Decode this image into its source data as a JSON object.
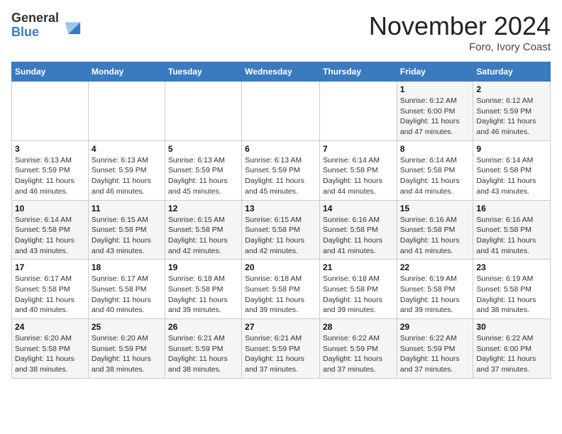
{
  "header": {
    "logo_general": "General",
    "logo_blue": "Blue",
    "month_title": "November 2024",
    "location": "Foro, Ivory Coast"
  },
  "weekdays": [
    "Sunday",
    "Monday",
    "Tuesday",
    "Wednesday",
    "Thursday",
    "Friday",
    "Saturday"
  ],
  "weeks": [
    [
      {
        "day": "",
        "info": ""
      },
      {
        "day": "",
        "info": ""
      },
      {
        "day": "",
        "info": ""
      },
      {
        "day": "",
        "info": ""
      },
      {
        "day": "",
        "info": ""
      },
      {
        "day": "1",
        "info": "Sunrise: 6:12 AM\nSunset: 6:00 PM\nDaylight: 11 hours and 47 minutes."
      },
      {
        "day": "2",
        "info": "Sunrise: 6:12 AM\nSunset: 5:59 PM\nDaylight: 11 hours and 46 minutes."
      }
    ],
    [
      {
        "day": "3",
        "info": "Sunrise: 6:13 AM\nSunset: 5:59 PM\nDaylight: 11 hours and 46 minutes."
      },
      {
        "day": "4",
        "info": "Sunrise: 6:13 AM\nSunset: 5:59 PM\nDaylight: 11 hours and 46 minutes."
      },
      {
        "day": "5",
        "info": "Sunrise: 6:13 AM\nSunset: 5:59 PM\nDaylight: 11 hours and 45 minutes."
      },
      {
        "day": "6",
        "info": "Sunrise: 6:13 AM\nSunset: 5:59 PM\nDaylight: 11 hours and 45 minutes."
      },
      {
        "day": "7",
        "info": "Sunrise: 6:14 AM\nSunset: 5:58 PM\nDaylight: 11 hours and 44 minutes."
      },
      {
        "day": "8",
        "info": "Sunrise: 6:14 AM\nSunset: 5:58 PM\nDaylight: 11 hours and 44 minutes."
      },
      {
        "day": "9",
        "info": "Sunrise: 6:14 AM\nSunset: 5:58 PM\nDaylight: 11 hours and 43 minutes."
      }
    ],
    [
      {
        "day": "10",
        "info": "Sunrise: 6:14 AM\nSunset: 5:58 PM\nDaylight: 11 hours and 43 minutes."
      },
      {
        "day": "11",
        "info": "Sunrise: 6:15 AM\nSunset: 5:58 PM\nDaylight: 11 hours and 43 minutes."
      },
      {
        "day": "12",
        "info": "Sunrise: 6:15 AM\nSunset: 5:58 PM\nDaylight: 11 hours and 42 minutes."
      },
      {
        "day": "13",
        "info": "Sunrise: 6:15 AM\nSunset: 5:58 PM\nDaylight: 11 hours and 42 minutes."
      },
      {
        "day": "14",
        "info": "Sunrise: 6:16 AM\nSunset: 5:58 PM\nDaylight: 11 hours and 41 minutes."
      },
      {
        "day": "15",
        "info": "Sunrise: 6:16 AM\nSunset: 5:58 PM\nDaylight: 11 hours and 41 minutes."
      },
      {
        "day": "16",
        "info": "Sunrise: 6:16 AM\nSunset: 5:58 PM\nDaylight: 11 hours and 41 minutes."
      }
    ],
    [
      {
        "day": "17",
        "info": "Sunrise: 6:17 AM\nSunset: 5:58 PM\nDaylight: 11 hours and 40 minutes."
      },
      {
        "day": "18",
        "info": "Sunrise: 6:17 AM\nSunset: 5:58 PM\nDaylight: 11 hours and 40 minutes."
      },
      {
        "day": "19",
        "info": "Sunrise: 6:18 AM\nSunset: 5:58 PM\nDaylight: 11 hours and 39 minutes."
      },
      {
        "day": "20",
        "info": "Sunrise: 6:18 AM\nSunset: 5:58 PM\nDaylight: 11 hours and 39 minutes."
      },
      {
        "day": "21",
        "info": "Sunrise: 6:18 AM\nSunset: 5:58 PM\nDaylight: 11 hours and 39 minutes."
      },
      {
        "day": "22",
        "info": "Sunrise: 6:19 AM\nSunset: 5:58 PM\nDaylight: 11 hours and 39 minutes."
      },
      {
        "day": "23",
        "info": "Sunrise: 6:19 AM\nSunset: 5:58 PM\nDaylight: 11 hours and 38 minutes."
      }
    ],
    [
      {
        "day": "24",
        "info": "Sunrise: 6:20 AM\nSunset: 5:58 PM\nDaylight: 11 hours and 38 minutes."
      },
      {
        "day": "25",
        "info": "Sunrise: 6:20 AM\nSunset: 5:59 PM\nDaylight: 11 hours and 38 minutes."
      },
      {
        "day": "26",
        "info": "Sunrise: 6:21 AM\nSunset: 5:59 PM\nDaylight: 11 hours and 38 minutes."
      },
      {
        "day": "27",
        "info": "Sunrise: 6:21 AM\nSunset: 5:59 PM\nDaylight: 11 hours and 37 minutes."
      },
      {
        "day": "28",
        "info": "Sunrise: 6:22 AM\nSunset: 5:59 PM\nDaylight: 11 hours and 37 minutes."
      },
      {
        "day": "29",
        "info": "Sunrise: 6:22 AM\nSunset: 5:59 PM\nDaylight: 11 hours and 37 minutes."
      },
      {
        "day": "30",
        "info": "Sunrise: 6:22 AM\nSunset: 6:00 PM\nDaylight: 11 hours and 37 minutes."
      }
    ]
  ]
}
